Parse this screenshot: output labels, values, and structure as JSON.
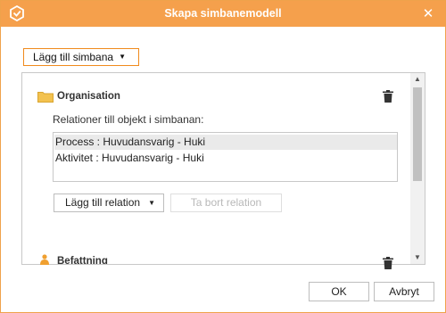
{
  "window": {
    "title": "Skapa simbanemodell",
    "accent_color": "#f5a04c",
    "close_glyph": "✕",
    "logo_icon": "app-logo-icon"
  },
  "toolbar": {
    "add_lane_label": "Lägg till simbana",
    "caret": "▼"
  },
  "sections": [
    {
      "title": "Organisation",
      "icon": "folder-icon",
      "relations_label": "Relationer till objekt i simbanan:",
      "relations": [
        {
          "text": "Process : Huvudansvarig - Huki",
          "selected": true
        },
        {
          "text": "Aktivitet : Huvudansvarig - Huki",
          "selected": false
        }
      ],
      "add_relation_label": "Lägg till relation",
      "remove_relation_label": "Ta bort relation",
      "remove_relation_enabled": false
    },
    {
      "title": "Befattning",
      "icon": "person-icon"
    }
  ],
  "scrollbar": {
    "up_glyph": "▲",
    "down_glyph": "▼"
  },
  "footer": {
    "ok_label": "OK",
    "cancel_label": "Avbryt"
  }
}
